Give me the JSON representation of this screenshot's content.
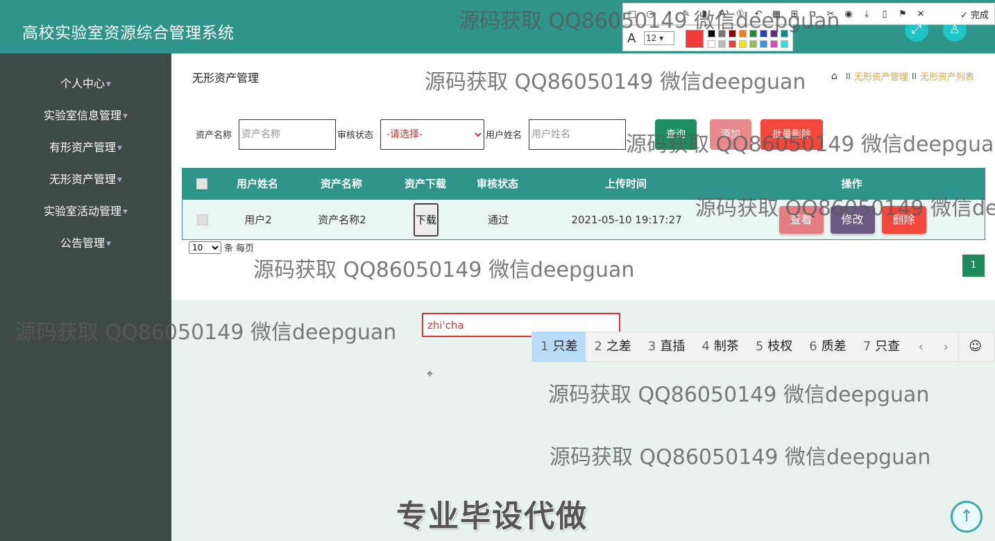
{
  "app": {
    "title": "高校实验室资源综合管理系统"
  },
  "header": {
    "icons": [
      "expand-icon",
      "user-icon"
    ]
  },
  "sidebar": {
    "items": [
      {
        "label": "个人中心"
      },
      {
        "label": "实验室信息管理"
      },
      {
        "label": "有形资产管理"
      },
      {
        "label": "无形资产管理"
      },
      {
        "label": "实验室活动管理"
      },
      {
        "label": "公告管理"
      }
    ]
  },
  "page": {
    "title": "无形资产管理",
    "breadcrumb": [
      "无形资产管理",
      "无形资产列表"
    ]
  },
  "filters": {
    "asset_name_label": "资产名称",
    "asset_name_placeholder": "资产名称",
    "review_label": "审核状态",
    "review_selected": "-请选择-",
    "user_label": "用户姓名",
    "user_placeholder": "用户姓名"
  },
  "toolbar": {
    "search": "查询",
    "add": "添加",
    "batch_delete": "批量删除"
  },
  "table": {
    "columns": [
      "用户姓名",
      "资产名称",
      "资产下载",
      "审核状态",
      "上传时间",
      "操作"
    ],
    "rows": [
      {
        "user": "用户2",
        "asset": "资产名称2",
        "download": "下载",
        "status": "通过",
        "time": "2021-05-10 19:17:27",
        "view": "查看",
        "edit": "修改",
        "delete": "删除"
      }
    ]
  },
  "pagination": {
    "page_size": "10",
    "per_page_text": "条 每页",
    "current": "1"
  },
  "watermark": {
    "text": "源码获取 QQ86050149 微信deepguan",
    "banner": "专业毕设代做"
  },
  "snap_toolbar": {
    "done": "完成",
    "font_size": "12"
  },
  "ime": {
    "input": "zhi'cha",
    "candidates": [
      {
        "n": "1",
        "w": "只差"
      },
      {
        "n": "2",
        "w": "之差"
      },
      {
        "n": "3",
        "w": "直插"
      },
      {
        "n": "4",
        "w": "制茶"
      },
      {
        "n": "5",
        "w": "枝杈"
      },
      {
        "n": "6",
        "w": "质差"
      },
      {
        "n": "7",
        "w": "只查"
      }
    ]
  },
  "colors": {
    "primary": "#2f958a",
    "sidebar": "#3e4a48",
    "search_btn": "#1d8e62",
    "add_btn": "#e98b8d",
    "delete_btn": "#f2473d",
    "view_btn": "#e47d82",
    "edit_btn": "#6b5a83",
    "remove_btn": "#f2473d"
  }
}
